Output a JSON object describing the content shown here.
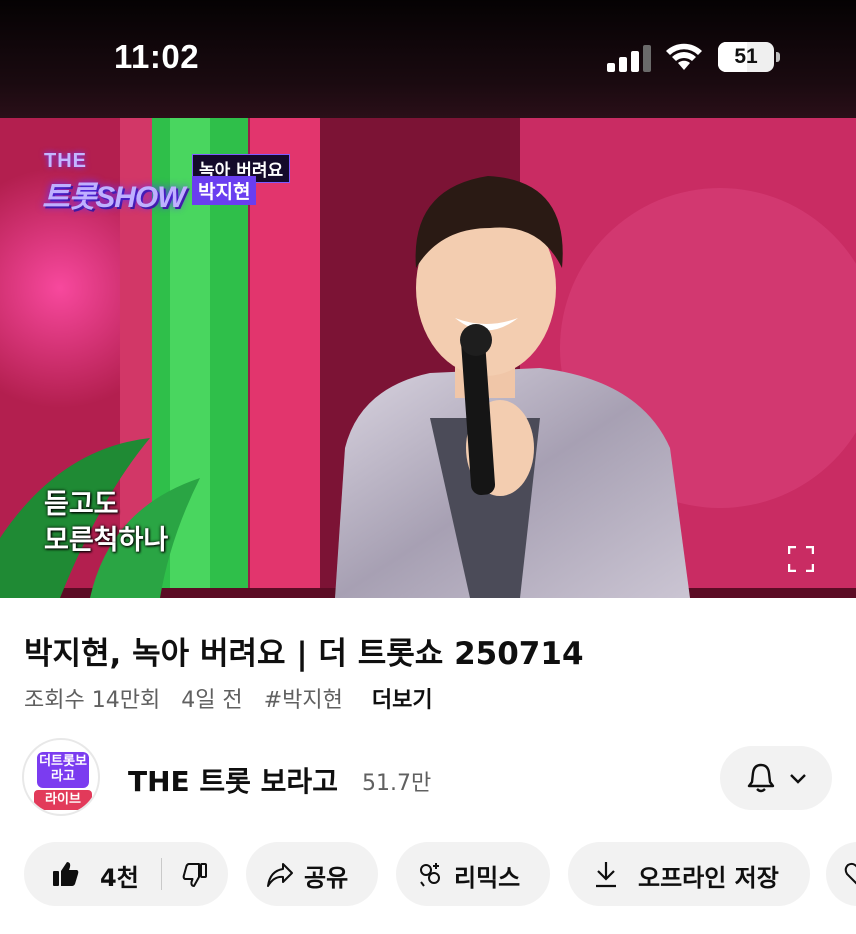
{
  "status_bar": {
    "time": "11:02",
    "battery_level": "51",
    "icons": [
      "cellular-signal-icon",
      "wifi-icon",
      "battery-icon"
    ]
  },
  "video": {
    "logo_the": "THE",
    "logo_main": "트롯SHOW",
    "song_tag": "녹아 버려요",
    "singer_tag": "박지현",
    "lyrics": [
      "듣고도",
      "모른척하나"
    ],
    "fullscreen_icon": "fullscreen-icon"
  },
  "details": {
    "title": "박지현, 녹아 버려요 | 더 트롯쇼 250714",
    "views": "조회수 14만회",
    "age": "4일 전",
    "hashtag": "#박지현",
    "more": "더보기"
  },
  "channel": {
    "avatar_top": "더트롯보라고",
    "avatar_bottom": "라이브",
    "name": "THE 트롯 보라고",
    "subscribers": "51.7만",
    "bell_icon": "bell-icon",
    "chevron_icon": "chevron-down-icon"
  },
  "actions": {
    "like_count": "4천",
    "share": "공유",
    "remix": "리믹스",
    "save_offline": "오프라인 저장"
  },
  "colors": {
    "pill_bg": "#f2f2f2",
    "text_primary": "#0f0f0f",
    "text_secondary": "#606060",
    "video_accent": "#c6285a"
  }
}
